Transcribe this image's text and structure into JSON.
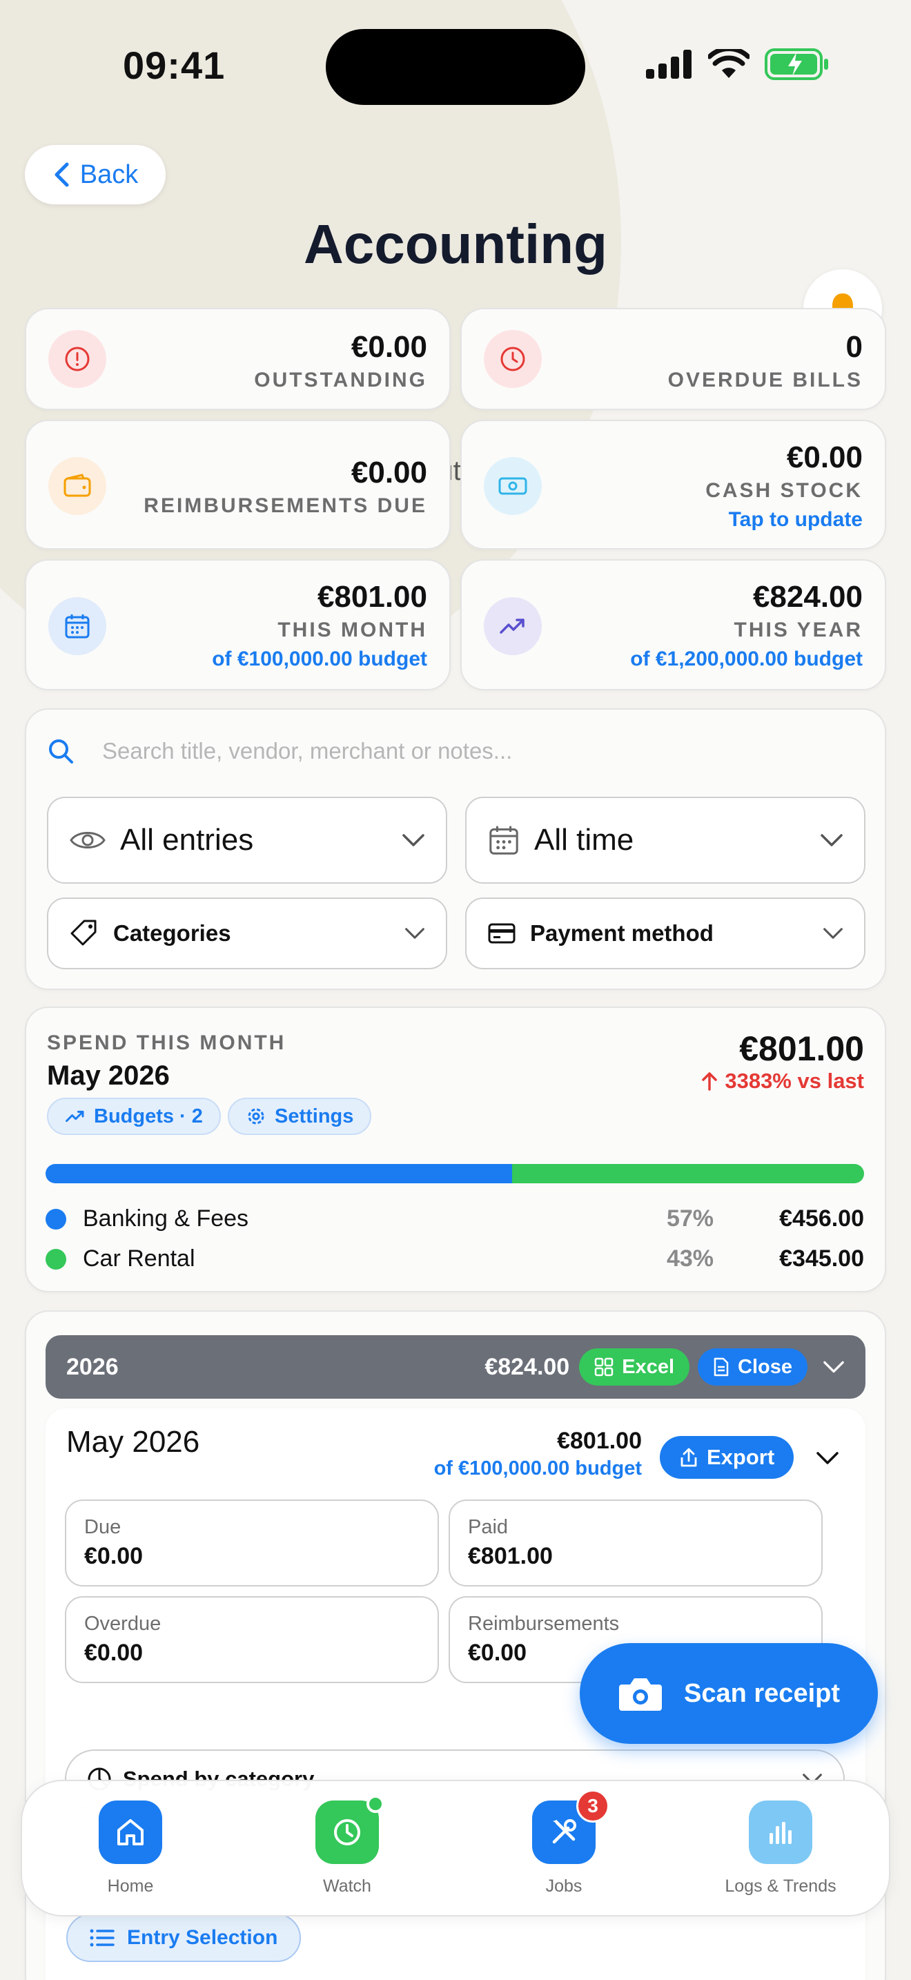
{
  "status_bar": {
    "time": "09:41"
  },
  "header": {
    "back_label": "Back",
    "title": "Accounting",
    "subtitle": "€0.00 outstanding"
  },
  "stats": [
    {
      "value": "€0.00",
      "label": "OUTSTANDING",
      "icon": "alert-circle-icon"
    },
    {
      "value": "0",
      "label": "OVERDUE BILLS",
      "icon": "clock-icon"
    },
    {
      "value": "€0.00",
      "label": "REIMBURSEMENTS DUE",
      "icon": "wallet-icon"
    },
    {
      "value": "€0.00",
      "label": "CASH STOCK",
      "sub": "Tap to update",
      "icon": "cash-icon"
    },
    {
      "value": "€801.00",
      "label": "THIS MONTH",
      "sub": "of €100,000.00 budget",
      "icon": "calendar-icon"
    },
    {
      "value": "€824.00",
      "label": "THIS YEAR",
      "sub": "of €1,200,000.00 budget",
      "icon": "trending-up-icon"
    }
  ],
  "filters": {
    "search_placeholder": "Search title, vendor, merchant or notes...",
    "entries": "All entries",
    "period": "All time",
    "categories": "Categories",
    "payment": "Payment method"
  },
  "spend": {
    "eyebrow": "SPEND THIS MONTH",
    "month": "May 2026",
    "amount": "€801.00",
    "trend": "3383% vs last",
    "budgets_chip": "Budgets · 2",
    "settings_chip": "Settings",
    "categories": [
      {
        "name": "Banking & Fees",
        "pct": "57%",
        "share": 57,
        "amount": "€456.00",
        "color": "#1a7cf0"
      },
      {
        "name": "Car Rental",
        "pct": "43%",
        "share": 43,
        "amount": "€345.00",
        "color": "#34c759"
      }
    ]
  },
  "year": {
    "label": "2026",
    "amount": "€824.00",
    "excel_label": "Excel",
    "close_label": "Close",
    "month": {
      "title": "May 2026",
      "amount": "€801.00",
      "budget": "of €100,000.00 budget",
      "export_label": "Export",
      "boxes": [
        {
          "label": "Due",
          "value": "€0.00"
        },
        {
          "label": "Paid",
          "value": "€801.00"
        },
        {
          "label": "Overdue",
          "value": "€0.00"
        },
        {
          "label": "Reimbursements",
          "value": "€0.00"
        }
      ],
      "spend_by_category": "Spend by category"
    }
  },
  "fab": {
    "label": "Scan receipt"
  },
  "tabbar": [
    {
      "label": "Home",
      "color": "#1a7cf0"
    },
    {
      "label": "Watch",
      "color": "#34c759"
    },
    {
      "label": "Jobs",
      "color": "#1a7cf0",
      "badge": "3"
    },
    {
      "label": "Logs & Trends",
      "color": "#7ec8f5"
    }
  ],
  "entry_selection": "Entry Selection",
  "colors": {
    "accent": "#1a7cf0",
    "success": "#34c759",
    "danger": "#e53935"
  }
}
